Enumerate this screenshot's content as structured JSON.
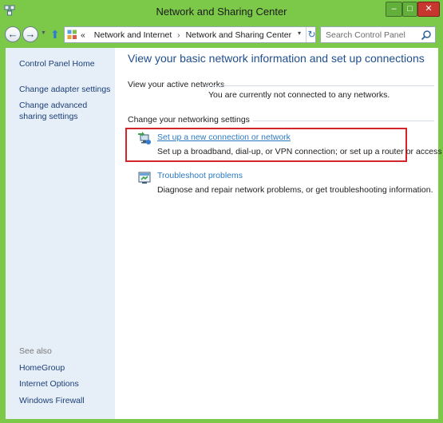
{
  "window": {
    "title": "Network and Sharing Center",
    "controls": {
      "minimize": "–",
      "maximize": "□",
      "close": "✕"
    }
  },
  "navbar": {
    "back_glyph": "←",
    "forward_glyph": "→",
    "up_glyph": "⬆",
    "address": {
      "prefix": "«",
      "segments": [
        "Network and Internet",
        "Network and Sharing Center"
      ],
      "separator": "›",
      "dropdown_glyph": "▾",
      "refresh_glyph": "↻"
    },
    "search": {
      "placeholder": "Search Control Panel"
    }
  },
  "sidebar": {
    "links": [
      "Control Panel Home",
      "Change adapter settings",
      "Change advanced sharing settings"
    ],
    "see_also_label": "See also",
    "see_also_links": [
      "HomeGroup",
      "Internet Options",
      "Windows Firewall"
    ]
  },
  "main": {
    "title": "View your basic network information and set up connections",
    "active_networks": {
      "heading": "View your active networks",
      "status": "You are currently not connected to any networks."
    },
    "change_settings": {
      "heading": "Change your networking settings",
      "tasks": [
        {
          "link": "Set up a new connection or network",
          "description": "Set up a broadband, dial-up, or VPN connection; or set up a router or access point.",
          "icon": "network-setup-icon",
          "highlighted": true
        },
        {
          "link": "Troubleshoot problems",
          "description": "Diagnose and repair network problems, or get troubleshooting information.",
          "icon": "troubleshoot-icon",
          "highlighted": false
        }
      ]
    }
  },
  "colors": {
    "window_frame": "#7cc94a",
    "sidebar_bg": "#e6eef7",
    "title_blue": "#1f4e8c",
    "link_blue": "#2b79c2",
    "highlight_red": "#d2262b",
    "close_red": "#c7372f"
  }
}
